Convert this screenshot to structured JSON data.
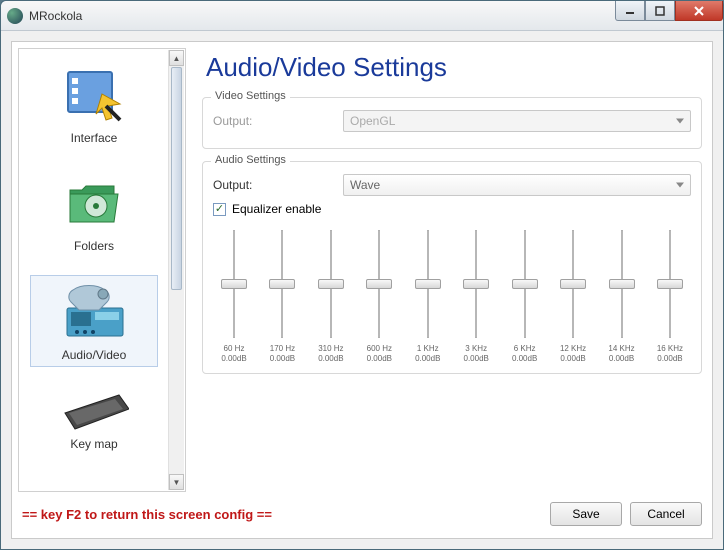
{
  "window": {
    "title": "MRockola"
  },
  "sidebar": {
    "items": [
      {
        "label": "Interface"
      },
      {
        "label": "Folders"
      },
      {
        "label": "Audio/Video"
      },
      {
        "label": "Key map"
      }
    ],
    "selected_index": 2
  },
  "page": {
    "title": "Audio/Video Settings",
    "video_group": {
      "title": "Video Settings",
      "output_label": "Output:",
      "output_value": "OpenGL",
      "enabled": false
    },
    "audio_group": {
      "title": "Audio Settings",
      "output_label": "Output:",
      "output_value": "Wave",
      "eq_checkbox_label": "Equalizer enable",
      "eq_checked": true,
      "eq_bands": [
        {
          "freq": "60 Hz",
          "gain": "0.00dB"
        },
        {
          "freq": "170 Hz",
          "gain": "0.00dB"
        },
        {
          "freq": "310 Hz",
          "gain": "0.00dB"
        },
        {
          "freq": "600 Hz",
          "gain": "0.00dB"
        },
        {
          "freq": "1 KHz",
          "gain": "0.00dB"
        },
        {
          "freq": "3 KHz",
          "gain": "0.00dB"
        },
        {
          "freq": "6 KHz",
          "gain": "0.00dB"
        },
        {
          "freq": "12 KHz",
          "gain": "0.00dB"
        },
        {
          "freq": "14 KHz",
          "gain": "0.00dB"
        },
        {
          "freq": "16 KHz",
          "gain": "0.00dB"
        }
      ]
    }
  },
  "footer": {
    "hint": "== key F2 to return this screen config ==",
    "save_label": "Save",
    "cancel_label": "Cancel"
  }
}
